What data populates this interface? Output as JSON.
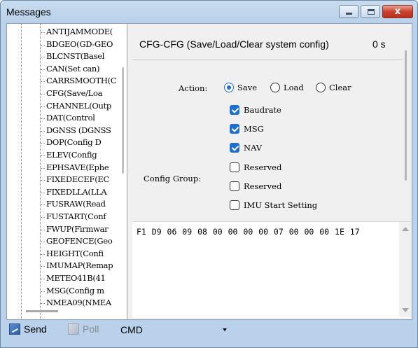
{
  "window": {
    "title": "Messages",
    "minimize": "minimize",
    "maximize": "maximize",
    "close_glyph": "x"
  },
  "tree": {
    "items": [
      "ANTIJAMMODE(",
      "BDGEO(GD-GEO",
      "BLCNST(Basel",
      "CAN(Set can)",
      "CARRSMOOTH(C",
      "CFG(Save/Loa",
      "CHANNEL(Outp",
      "DAT(Control",
      "DGNSS (DGNSS",
      "DOP(Config D",
      "ELEV(Config",
      "EPHSAVE(Ephe",
      "FIXEDECEF(EC",
      "FIXEDLLA(LLA",
      "FUSRAW(Read",
      "FUSTART(Conf",
      "FWUP(Firmwar",
      "GEOFENCE(Geo",
      "HEIGHT(Confi",
      "IMUMAP(Remap",
      "METEO41B(41",
      "MSG(Config m",
      "NMEA09(NMEA"
    ]
  },
  "panel": {
    "header": "CFG-CFG (Save/Load/Clear system config)",
    "elapsed": "0 s",
    "action_label": "Action:",
    "actions": [
      {
        "label": "Save",
        "selected": true
      },
      {
        "label": "Load",
        "selected": false
      },
      {
        "label": "Clear",
        "selected": false
      }
    ],
    "config_group_label": "Config Group:",
    "groups": [
      {
        "label": "Baudrate",
        "checked": true
      },
      {
        "label": "MSG",
        "checked": true
      },
      {
        "label": "NAV",
        "checked": true
      },
      {
        "label": "Reserved",
        "checked": false
      },
      {
        "label": "Reserved",
        "checked": false
      },
      {
        "label": "IMU Start Setting",
        "checked": false
      }
    ]
  },
  "hex": {
    "text": "F1 D9 06 09 08 00 00 00 00 07 00 00 00 1E 17"
  },
  "toolbar": {
    "send_label": "Send",
    "poll_label": "Poll",
    "cmd_value": "CMD"
  },
  "colors": {
    "accent": "#1f6fd1",
    "titlebar": "#b9d1ea",
    "close": "#c7422d"
  }
}
